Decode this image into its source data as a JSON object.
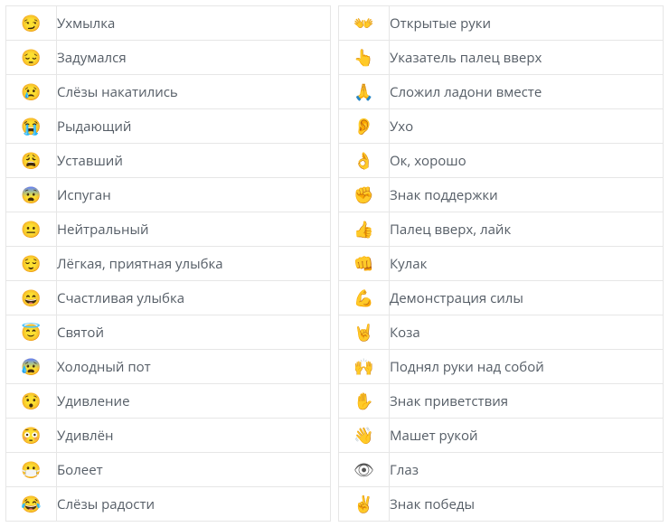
{
  "left": [
    {
      "emoji": "😏",
      "label": "Ухмылка"
    },
    {
      "emoji": "😔",
      "label": "Задумался"
    },
    {
      "emoji": "😢",
      "label": "Слёзы накатились"
    },
    {
      "emoji": "😭",
      "label": "Рыдающий"
    },
    {
      "emoji": "😩",
      "label": "Уставший"
    },
    {
      "emoji": "😨",
      "label": "Испуган"
    },
    {
      "emoji": "😐",
      "label": "Нейтральный"
    },
    {
      "emoji": "😌",
      "label": "Лёгкая, приятная улыбка"
    },
    {
      "emoji": "😄",
      "label": "Счастливая улыбка"
    },
    {
      "emoji": "😇",
      "label": "Святой"
    },
    {
      "emoji": "😰",
      "label": "Холодный пот"
    },
    {
      "emoji": "😯",
      "label": "Удивление"
    },
    {
      "emoji": "😳",
      "label": "Удивлён"
    },
    {
      "emoji": "😷",
      "label": "Болеет"
    },
    {
      "emoji": "😂",
      "label": "Слёзы радости"
    }
  ],
  "right": [
    {
      "emoji": "👐",
      "label": "Открытые руки"
    },
    {
      "emoji": "👆",
      "label": "Указатель палец вверх"
    },
    {
      "emoji": "🙏",
      "label": "Сложил ладони вместе"
    },
    {
      "emoji": "👂",
      "label": "Ухо"
    },
    {
      "emoji": "👌",
      "label": "Ок, хорошо"
    },
    {
      "emoji": "✊",
      "label": "Знак поддержки"
    },
    {
      "emoji": "👍",
      "label": "Палец вверх, лайк"
    },
    {
      "emoji": "👊",
      "label": "Кулак"
    },
    {
      "emoji": "💪",
      "label": "Демонстрация силы"
    },
    {
      "emoji": "🤘",
      "label": "Коза"
    },
    {
      "emoji": "🙌",
      "label": "Поднял руки над собой"
    },
    {
      "emoji": "✋",
      "label": "Знак приветствия"
    },
    {
      "emoji": "👋",
      "label": "Машет рукой"
    },
    {
      "emoji": "👁",
      "label": "Глаз"
    },
    {
      "emoji": "✌",
      "label": "Знак победы"
    }
  ]
}
